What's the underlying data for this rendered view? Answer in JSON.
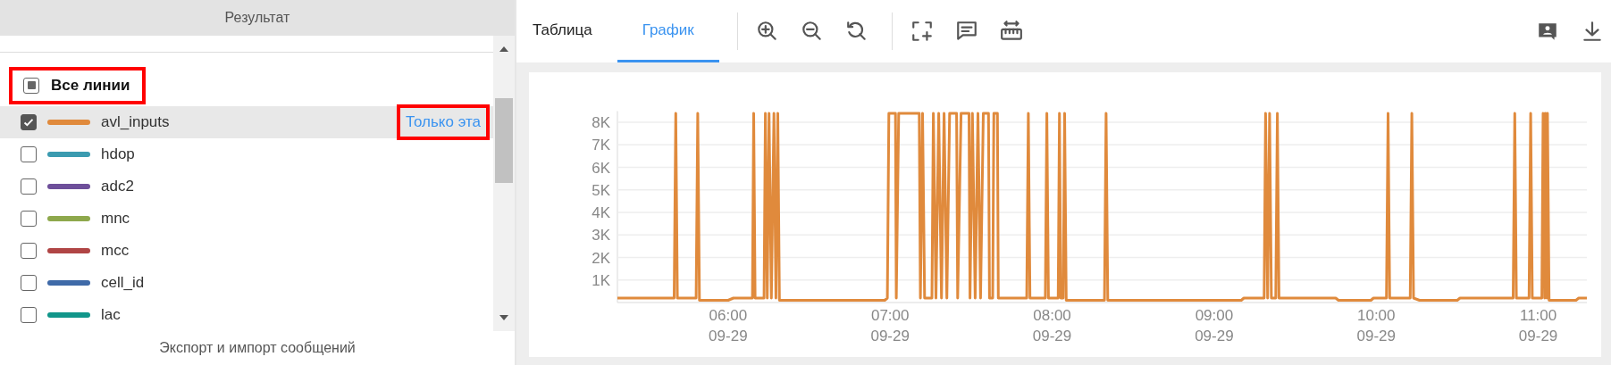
{
  "left_panel": {
    "title": "Результат",
    "footer": "Экспорт и импорт сообщений"
  },
  "all_lines": {
    "label": "Все линии",
    "indeterminate": true,
    "highlighted": true
  },
  "lines": [
    {
      "label": "avl_inputs",
      "color": "#e08a3c",
      "checked": true,
      "hovered": true,
      "only_this": {
        "label": "Только эта",
        "highlighted": true
      }
    },
    {
      "label": "hdop",
      "color": "#3b9bb0",
      "checked": false,
      "hovered": false
    },
    {
      "label": "adc2",
      "color": "#6e4f9a",
      "checked": false,
      "hovered": false
    },
    {
      "label": "mnc",
      "color": "#8ea84c",
      "checked": false,
      "hovered": false
    },
    {
      "label": "mcc",
      "color": "#b04545",
      "checked": false,
      "hovered": false
    },
    {
      "label": "cell_id",
      "color": "#3f6aa8",
      "checked": false,
      "hovered": false
    },
    {
      "label": "lac",
      "color": "#11968a",
      "checked": false,
      "hovered": false
    }
  ],
  "tabs": [
    {
      "label": "Таблица",
      "selected": false
    },
    {
      "label": "График",
      "selected": true
    }
  ],
  "toolbar": [
    {
      "kind": "zoom-in"
    },
    {
      "kind": "zoom-out"
    },
    {
      "kind": "reset"
    },
    {
      "kind": "divider"
    },
    {
      "kind": "select"
    },
    {
      "kind": "comment"
    },
    {
      "kind": "measure"
    }
  ],
  "toolbar_right": [
    {
      "kind": "user-note"
    },
    {
      "kind": "download"
    }
  ],
  "chart": {
    "chart_data": {
      "type": "line",
      "grid": true,
      "xlim": [
        5.317,
        11.3
      ],
      "ylim": [
        0,
        8500
      ],
      "yticks": [
        {
          "value": 1000,
          "label": "1K"
        },
        {
          "value": 2000,
          "label": "2K"
        },
        {
          "value": 3000,
          "label": "3K"
        },
        {
          "value": 4000,
          "label": "4K"
        },
        {
          "value": 5000,
          "label": "5K"
        },
        {
          "value": 6000,
          "label": "6K"
        },
        {
          "value": 7000,
          "label": "7K"
        },
        {
          "value": 8000,
          "label": "8K"
        }
      ],
      "xticks": [
        {
          "value": 6,
          "label": "06:00"
        },
        {
          "value": 7,
          "label": "07:00"
        },
        {
          "value": 8,
          "label": "08:00"
        },
        {
          "value": 9,
          "label": "09:00"
        },
        {
          "value": 10,
          "label": "10:00"
        },
        {
          "value": 11,
          "label": "11:00"
        }
      ],
      "annotations": [
        "09-29",
        "09-29",
        "09-29",
        "09-29",
        "09-29",
        "09-29"
      ],
      "x": [
        5.317,
        5.667,
        5.677,
        5.687,
        5.803,
        5.813,
        5.823,
        6,
        6.033,
        6.15,
        6.158,
        6.167,
        6.222,
        6.23,
        6.242,
        6.253,
        6.267,
        6.283,
        6.295,
        6.307,
        6.317,
        6.967,
        6.983,
        6.992,
        7.033,
        7.038,
        7.053,
        7.18,
        7.187,
        7.2,
        7.213,
        7.258,
        7.267,
        7.283,
        7.3,
        7.317,
        7.333,
        7.35,
        7.367,
        7.41,
        7.417,
        7.438,
        7.487,
        7.493,
        7.508,
        7.525,
        7.542,
        7.558,
        7.575,
        7.607,
        7.613,
        7.633,
        7.64,
        7.662,
        7.668,
        7.843,
        7.853,
        7.863,
        7.958,
        7.967,
        7.977,
        8.037,
        8.045,
        8.053,
        8.068,
        8.077,
        8.087,
        8.323,
        8.333,
        8.343,
        9.167,
        9.183,
        9.308,
        9.317,
        9.33,
        9.342,
        9.353,
        9.38,
        9.39,
        9.4,
        9.75,
        9.767,
        9.967,
        9.983,
        10.063,
        10.073,
        10.083,
        10.21,
        10.22,
        10.23,
        10.267,
        10.5,
        10.517,
        10.845,
        10.855,
        10.865,
        10.943,
        10.953,
        10.963,
        11.022,
        11.03,
        11.04,
        11.043,
        11.053,
        11.057,
        11.067,
        11.233,
        11.25,
        11.3
      ],
      "series": [
        {
          "color": "#e08a3c",
          "values": [
            200,
            200,
            8400,
            200,
            200,
            8400,
            100,
            100,
            200,
            200,
            8400,
            200,
            200,
            8400,
            200,
            8400,
            200,
            8400,
            200,
            8400,
            100,
            100,
            200,
            8400,
            8400,
            200,
            8400,
            8400,
            200,
            8400,
            200,
            200,
            8400,
            200,
            8400,
            200,
            8400,
            200,
            8400,
            8400,
            200,
            8400,
            8400,
            200,
            8400,
            200,
            8400,
            200,
            8400,
            8400,
            200,
            200,
            8400,
            8400,
            200,
            200,
            8400,
            200,
            200,
            8400,
            200,
            200,
            8400,
            200,
            200,
            8400,
            100,
            100,
            8400,
            100,
            100,
            200,
            200,
            8400,
            200,
            8400,
            200,
            200,
            8400,
            200,
            200,
            100,
            100,
            200,
            200,
            8400,
            200,
            200,
            8400,
            200,
            100,
            100,
            200,
            200,
            8400,
            200,
            200,
            8400,
            200,
            200,
            8400,
            200,
            8400,
            200,
            8400,
            100,
            100,
            200,
            200
          ]
        }
      ]
    }
  }
}
